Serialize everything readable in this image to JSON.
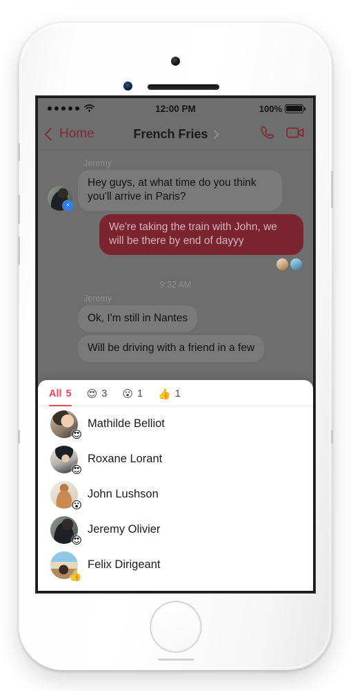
{
  "status_bar": {
    "signal_dots": 5,
    "wifi": "wifi-icon",
    "time": "12:00 PM",
    "battery_percent": "100%"
  },
  "nav_bar": {
    "back_label": "Home",
    "title": "French Fries",
    "title_chevron": "chevron-right-icon",
    "call_icon": "phone-icon",
    "video_icon": "video-camera-icon",
    "accent_color": "#7e2c36"
  },
  "conversation": {
    "groups": [
      {
        "sender": "Jeremy",
        "messages": [
          {
            "direction": "in",
            "text": "Hey guys, at what time do you think you'll arrive in Paris?",
            "has_avatar": true,
            "badge": "messenger-badge"
          }
        ]
      },
      {
        "sender": "",
        "messages": [
          {
            "direction": "out",
            "text": "We're taking the train with John, we will be there by end of dayyy",
            "reactors": 2
          }
        ]
      }
    ],
    "timestamp": "9:32 AM",
    "second_group": {
      "sender": "Jeremy",
      "messages": [
        {
          "direction": "in",
          "text": "Ok, I'm still in Nantes"
        },
        {
          "direction": "in",
          "text": "Will be driving with a friend in a few"
        }
      ]
    },
    "bubble_in_color": "#7a7a7a",
    "bubble_out_color": "#7b2430"
  },
  "reactions_sheet": {
    "active_color": "#f2425c",
    "tabs": [
      {
        "id": "all",
        "label": "All",
        "emoji": "",
        "count": "5",
        "active": true
      },
      {
        "id": "love",
        "label": "",
        "emoji": "😍",
        "count": "3",
        "active": false
      },
      {
        "id": "wow",
        "label": "",
        "emoji": "😮",
        "count": "1",
        "active": false
      },
      {
        "id": "thumbsup",
        "label": "",
        "emoji": "👍",
        "count": "1",
        "active": false
      }
    ],
    "people": [
      {
        "name": "Mathilde Belliot",
        "reaction": "😍",
        "avatar": "ph-mathilde"
      },
      {
        "name": "Roxane Lorant",
        "reaction": "😍",
        "avatar": "ph-roxane"
      },
      {
        "name": "John Lushson",
        "reaction": "😮",
        "avatar": "ph-john"
      },
      {
        "name": "Jeremy Olivier",
        "reaction": "😍",
        "avatar": "ph-jeremy"
      },
      {
        "name": "Felix Dirigeant",
        "reaction": "👍",
        "avatar": "ph-felix"
      }
    ]
  }
}
